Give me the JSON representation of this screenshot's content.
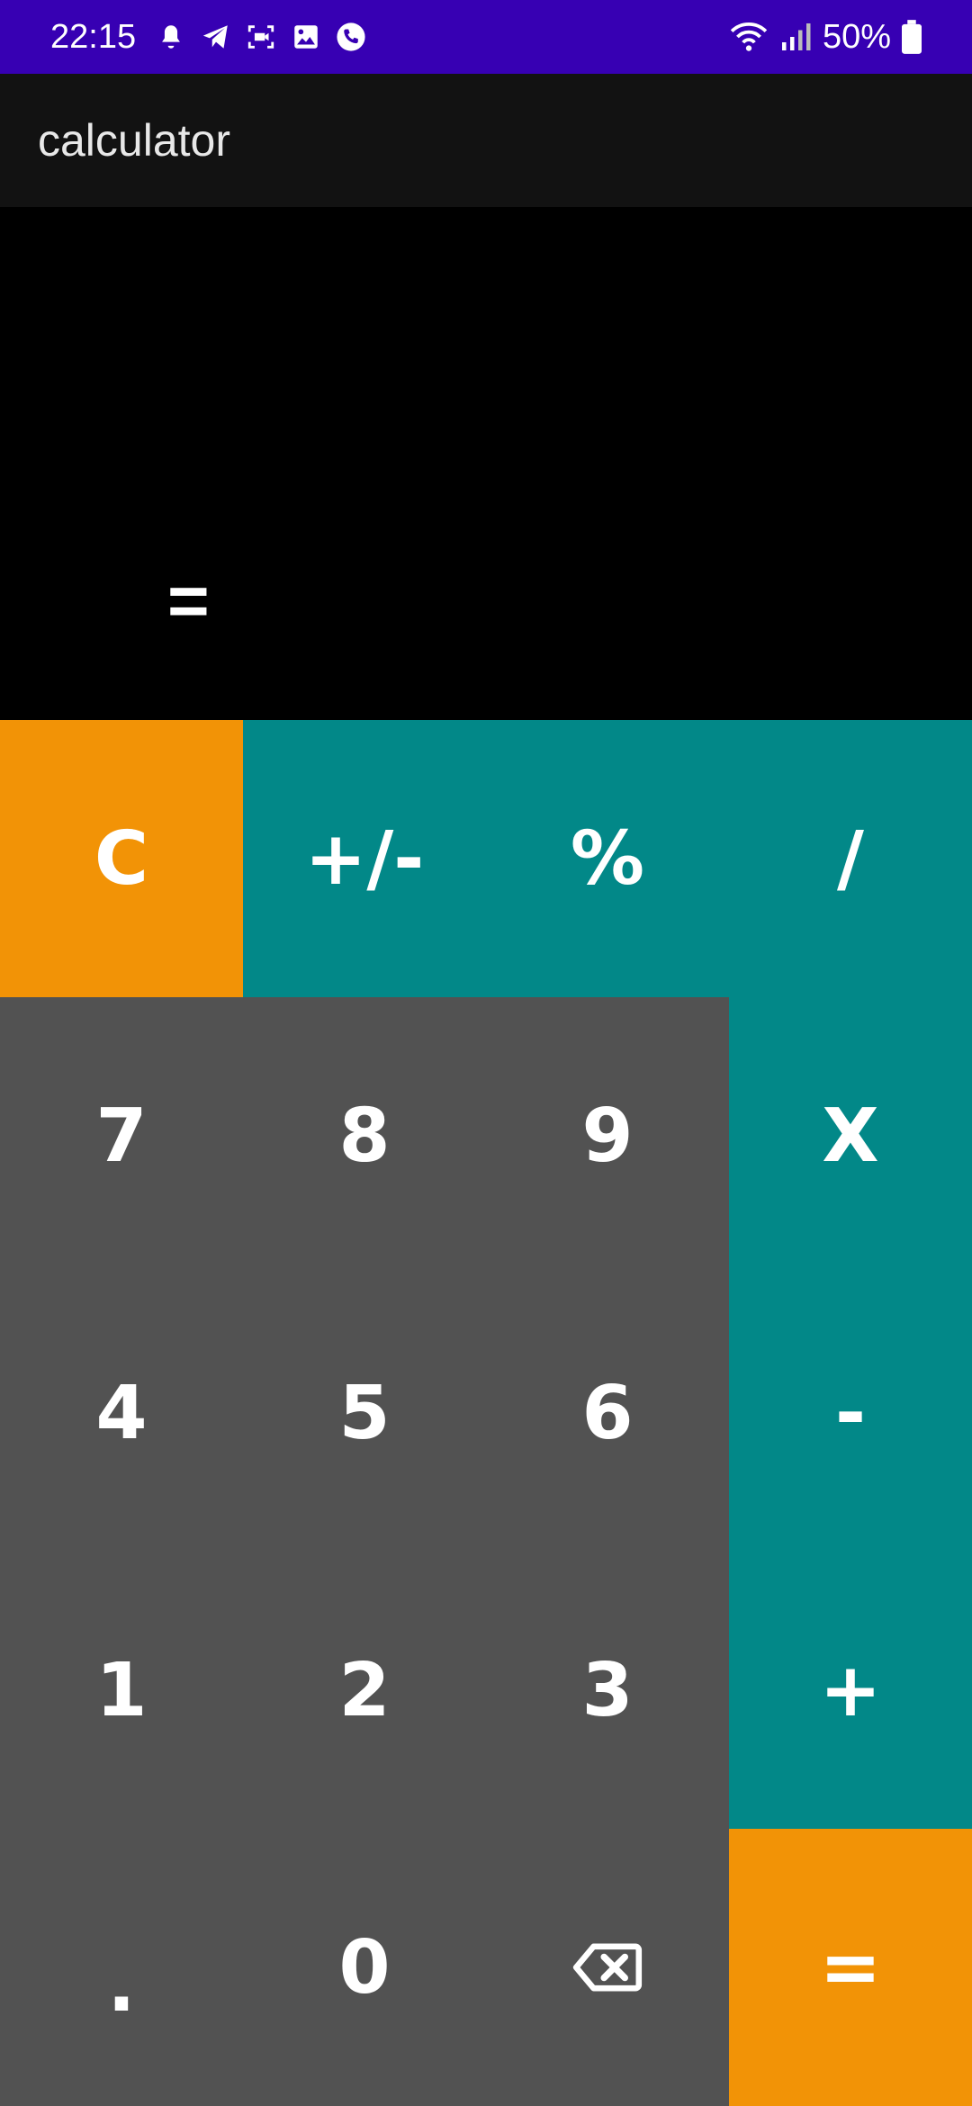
{
  "status_bar": {
    "time": "22:15",
    "battery": "50%",
    "icons_left": [
      "notification-bell-icon",
      "telegram-icon",
      "screen-record-icon",
      "gallery-icon",
      "call-icon"
    ],
    "icons_right": [
      "wifi-icon",
      "signal-icon",
      "battery-icon"
    ]
  },
  "app_bar": {
    "title": "calculator"
  },
  "display": {
    "expression": "",
    "result_label": "="
  },
  "keys": {
    "clear": "C",
    "sign": "+/-",
    "percent": "%",
    "divide": "/",
    "seven": "7",
    "eight": "8",
    "nine": "9",
    "multiply": "X",
    "four": "4",
    "five": "5",
    "six": "6",
    "minus": "-",
    "one": "1",
    "two": "2",
    "three": "3",
    "plus": "+",
    "dot": ".",
    "zero": "0",
    "backspace_icon": "backspace-icon",
    "equals": "="
  },
  "colors": {
    "status_bar": "#3700b3",
    "app_bar": "#121212",
    "orange": "#f29306",
    "teal": "#028888",
    "gray": "#525252"
  }
}
